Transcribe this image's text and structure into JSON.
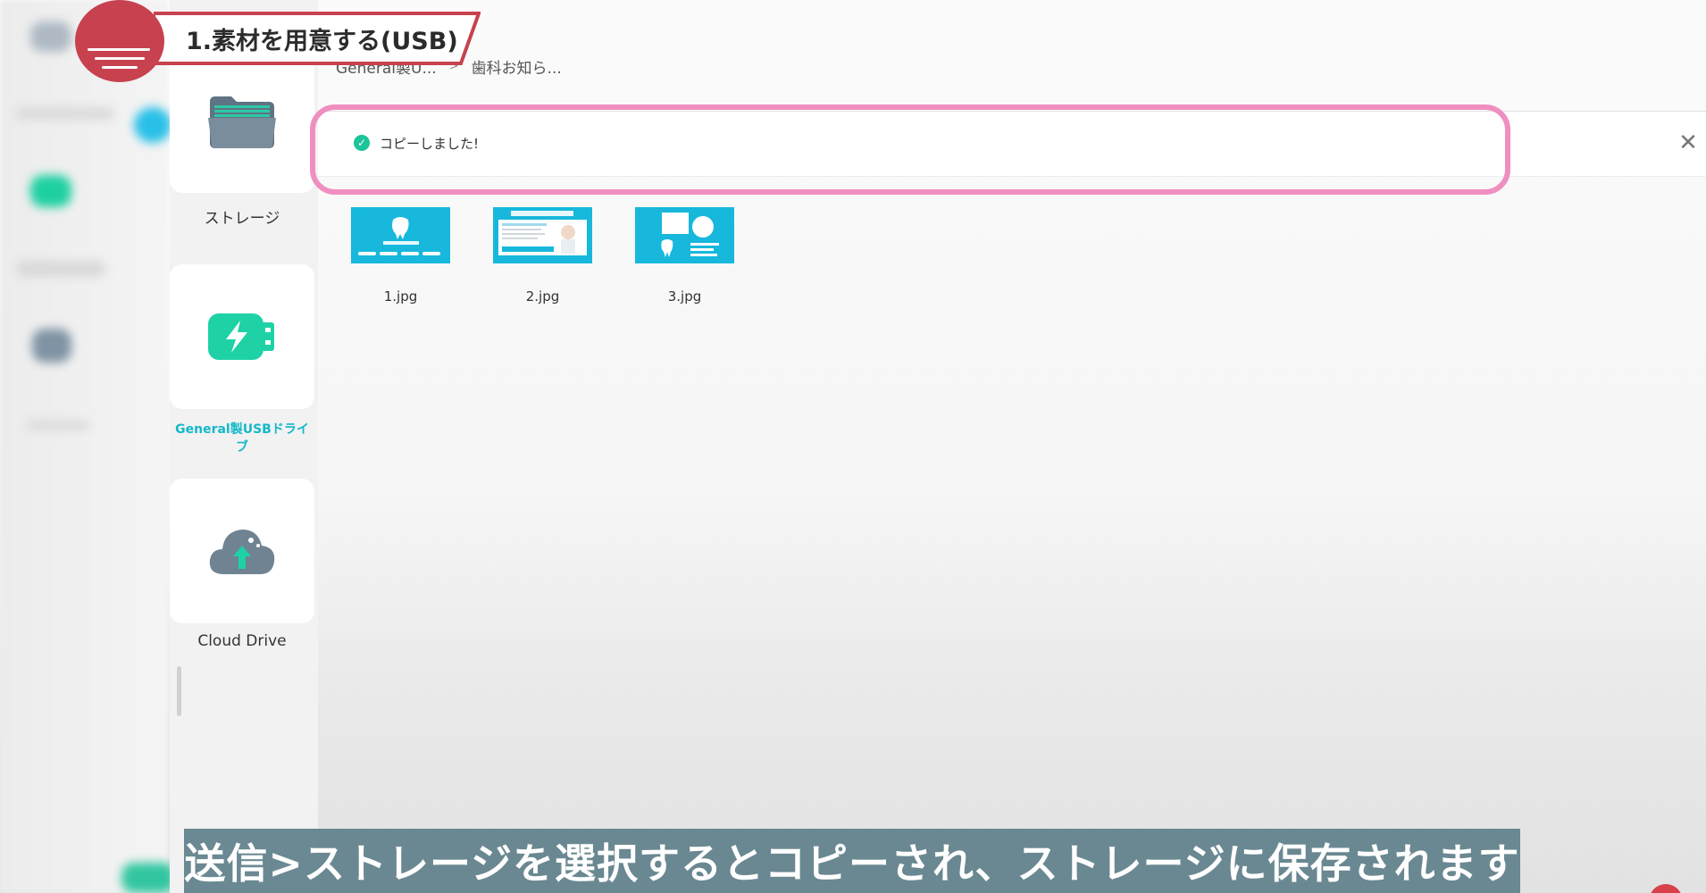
{
  "chapter": {
    "title": "1.素材を用意する(USB)"
  },
  "devices": [
    {
      "label": "ストレージ",
      "icon": "folder-icon"
    },
    {
      "label": "General製USBドライブ",
      "icon": "usb-drive-icon",
      "active": true
    },
    {
      "label": "Cloud Drive",
      "icon": "cloud-upload-icon"
    }
  ],
  "breadcrumb": {
    "root": "General製U...",
    "separator": ">",
    "current": "歯科お知ら..."
  },
  "toast": {
    "message": "コピーしました!",
    "icon": "check-circle-icon",
    "close_icon": "close-icon"
  },
  "files": [
    {
      "name": "1.jpg"
    },
    {
      "name": "2.jpg"
    },
    {
      "name": "3.jpg"
    }
  ],
  "caption": {
    "text": "送信>ストレージを選択するとコピーされ、ストレージに保存されます"
  },
  "colors": {
    "accent": "#14b8c8",
    "toast_check": "#1dc39a",
    "highlight": "#ef8fc0",
    "chapter_red": "#c8414f",
    "caption_bg": "#60808a"
  }
}
